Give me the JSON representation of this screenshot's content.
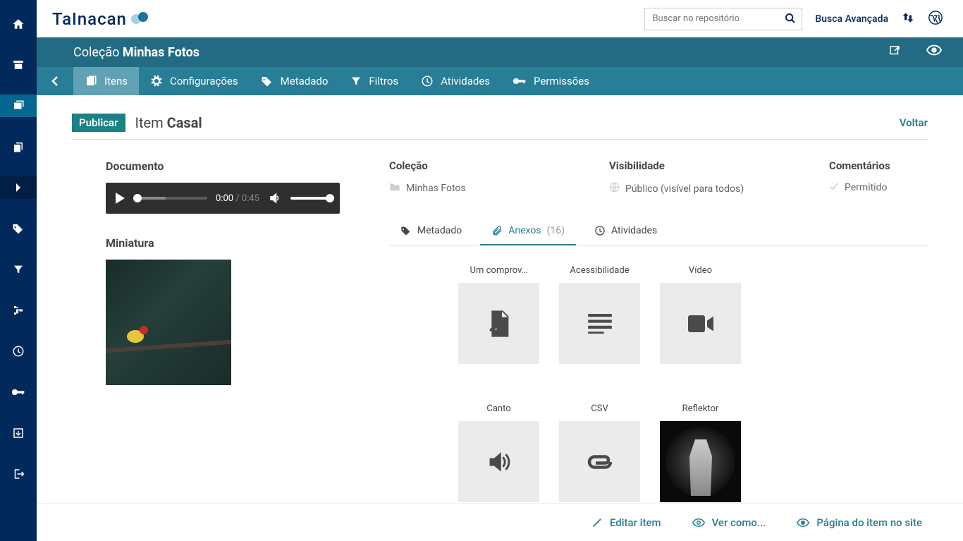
{
  "logo_text": "TaInacan",
  "search": {
    "placeholder": "Buscar no repositório"
  },
  "advanced_search": "Busca Avançada",
  "collection": {
    "prefix": "Coleção",
    "name": "Minhas Fotos"
  },
  "tabs": {
    "itens": "Itens",
    "config": "Configurações",
    "metadado": "Metadado",
    "filtros": "Filtros",
    "atividades": "Atividades",
    "permissoes": "Permissões"
  },
  "item": {
    "status": "Publicar",
    "title_prefix": "Item",
    "title_name": "Casal",
    "back": "Voltar"
  },
  "doc": {
    "heading": "Documento",
    "time_current": "0:00",
    "time_total": " / 0:45"
  },
  "thumb_heading": "Miniatura",
  "info": {
    "colecao_h": "Coleção",
    "colecao_v": "Minhas Fotos",
    "vis_h": "Visibilidade",
    "vis_v": "Público (visível para todos)",
    "com_h": "Comentários",
    "com_v": "Permitido"
  },
  "subtabs": {
    "metadado": "Metadado",
    "anexos": "Anexos",
    "anexos_count": "(16)",
    "atividades": "Atividades"
  },
  "attachments": [
    {
      "label": "Um comprov…",
      "type": "pdf"
    },
    {
      "label": "Acessibilidade",
      "type": "text"
    },
    {
      "label": "Vídeo",
      "type": "video"
    },
    {
      "label": "Canto",
      "type": "audio"
    },
    {
      "label": "CSV",
      "type": "attach"
    },
    {
      "label": "Reflektor",
      "type": "image"
    }
  ],
  "actions": {
    "edit": "Editar item",
    "viewas": "Ver como...",
    "sitepage": "Página do item no site"
  }
}
